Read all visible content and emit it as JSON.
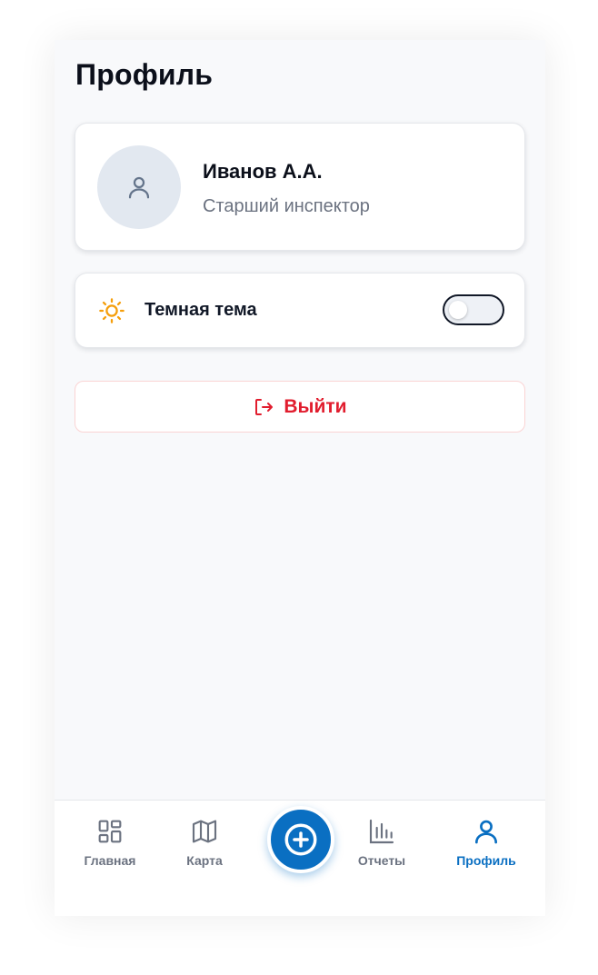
{
  "header": {
    "title": "Профиль"
  },
  "profile": {
    "name": "Иванов А.А.",
    "role": "Старший инспектор",
    "avatar_icon": "user-icon"
  },
  "settings": {
    "dark_theme_label": "Темная тема",
    "dark_theme_enabled": false,
    "icon": "sun-icon",
    "icon_color": "#f59e0b"
  },
  "logout": {
    "label": "Выйти",
    "icon": "logout-icon",
    "color": "#e11d2e"
  },
  "nav": {
    "items": [
      {
        "label": "Главная",
        "icon": "grid-icon"
      },
      {
        "label": "Карта",
        "icon": "map-icon"
      },
      {
        "label": "Отчеты",
        "icon": "bar-chart-icon"
      },
      {
        "label": "Профиль",
        "icon": "user-icon",
        "active": true
      }
    ],
    "fab_icon": "plus-circle-icon",
    "accent": "#0a6fc2"
  }
}
